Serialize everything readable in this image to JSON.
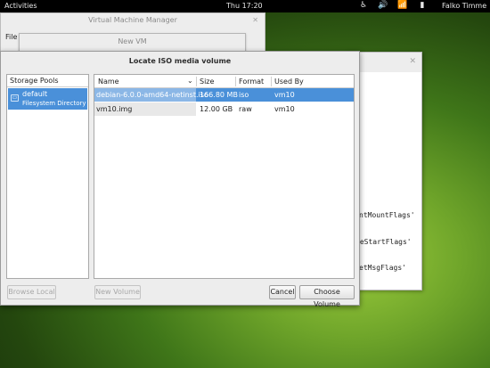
{
  "topbar": {
    "activities": "Activities",
    "clock": "Thu 17:20",
    "tray_icons": [
      "accessibility-icon",
      "volume-icon",
      "network-icon",
      "battery-icon"
    ],
    "user": "Falko Timme"
  },
  "vmm_window": {
    "title": "Virtual Machine Manager",
    "menu_file": "File"
  },
  "newvm_window": {
    "title": "New VM"
  },
  "console_window": {
    "lines": [
      "ntMountFlags'",
      "veStartFlags'",
      "etMsgFlags'"
    ]
  },
  "dialog": {
    "title": "Locate ISO media volume",
    "pools_header": "Storage Pools",
    "pools": [
      {
        "name": "default",
        "type": "Filesystem Directory",
        "icon": "folder-icon"
      }
    ],
    "volume_columns": [
      "Name",
      "Size",
      "Format",
      "Used By"
    ],
    "volumes": [
      {
        "name": "debian-6.0.0-amd64-netinst.iso",
        "size": "166.80 MB",
        "format": "iso",
        "used_by": "vm10"
      },
      {
        "name": "vm10.img",
        "size": "12.00 GB",
        "format": "raw",
        "used_by": "vm10"
      }
    ],
    "buttons": {
      "browse_local": "Browse Local",
      "new_volume": "New Volume",
      "cancel": "Cancel",
      "choose_volume": "Choose Volume"
    }
  },
  "colors": {
    "selection": "#4a90d9",
    "desktop": "#5f9a26"
  }
}
